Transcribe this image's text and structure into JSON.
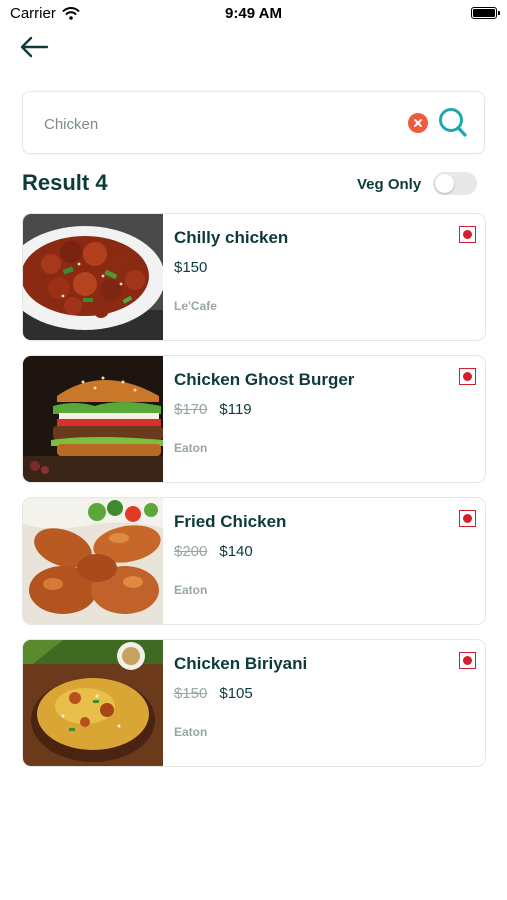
{
  "status_bar": {
    "carrier": "Carrier",
    "time": "9:49 AM"
  },
  "search": {
    "value": "Chicken"
  },
  "results": {
    "title": "Result 4",
    "veg_only_label": "Veg Only",
    "veg_only_on": false
  },
  "items": [
    {
      "name": "Chilly chicken",
      "old_price": "",
      "price": "$150",
      "restaurant": "Le'Cafe",
      "image": "chilly-chicken-photo"
    },
    {
      "name": "Chicken Ghost Burger",
      "old_price": "$170",
      "price": "$119",
      "restaurant": "Eaton",
      "image": "burger-photo"
    },
    {
      "name": "Fried Chicken",
      "old_price": "$200",
      "price": "$140",
      "restaurant": "Eaton",
      "image": "fried-chicken-photo"
    },
    {
      "name": "Chicken Biriyani",
      "old_price": "$150",
      "price": "$105",
      "restaurant": "Eaton",
      "image": "biriyani-photo"
    }
  ],
  "colors": {
    "primary": "#0d3b3a",
    "accent": "#1fa7b0",
    "clear": "#f05a3d",
    "nonveg": "#d1202a"
  },
  "icons": {
    "back": "arrow-left-icon",
    "clear": "clear-icon",
    "search": "search-icon",
    "nonveg": "non-veg-icon",
    "wifi": "wifi-icon",
    "battery": "battery-icon"
  }
}
